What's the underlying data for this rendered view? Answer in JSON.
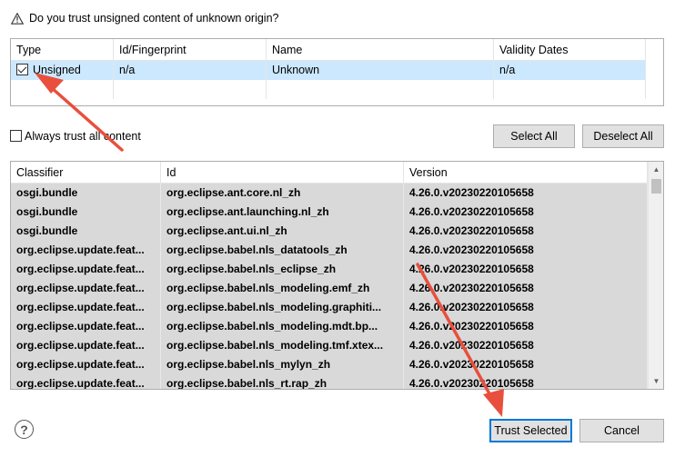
{
  "dialog": {
    "question": "Do you trust unsigned content of unknown origin?",
    "warning_icon": "warning-icon"
  },
  "trust_table": {
    "columns": [
      "Type",
      "Id/Fingerprint",
      "Name",
      "Validity Dates"
    ],
    "rows": [
      {
        "checked": true,
        "type": "Unsigned",
        "id": "n/a",
        "name": "Unknown",
        "validity": "n/a"
      }
    ]
  },
  "always_trust": {
    "label": "Always trust all content",
    "checked": false
  },
  "buttons": {
    "select_all": "Select All",
    "deselect_all": "Deselect All",
    "trust_selected": "Trust Selected",
    "cancel": "Cancel"
  },
  "content_table": {
    "columns": [
      "Classifier",
      "Id",
      "Version"
    ],
    "rows": [
      [
        "osgi.bundle",
        "org.eclipse.ant.core.nl_zh",
        "4.26.0.v20230220105658"
      ],
      [
        "osgi.bundle",
        "org.eclipse.ant.launching.nl_zh",
        "4.26.0.v20230220105658"
      ],
      [
        "osgi.bundle",
        "org.eclipse.ant.ui.nl_zh",
        "4.26.0.v20230220105658"
      ],
      [
        "org.eclipse.update.feat...",
        "org.eclipse.babel.nls_datatools_zh",
        "4.26.0.v20230220105658"
      ],
      [
        "org.eclipse.update.feat...",
        "org.eclipse.babel.nls_eclipse_zh",
        "4.26.0.v20230220105658"
      ],
      [
        "org.eclipse.update.feat...",
        "org.eclipse.babel.nls_modeling.emf_zh",
        "4.26.0.v20230220105658"
      ],
      [
        "org.eclipse.update.feat...",
        "org.eclipse.babel.nls_modeling.graphiti...",
        "4.26.0.v20230220105658"
      ],
      [
        "org.eclipse.update.feat...",
        "org.eclipse.babel.nls_modeling.mdt.bp...",
        "4.26.0.v20230220105658"
      ],
      [
        "org.eclipse.update.feat...",
        "org.eclipse.babel.nls_modeling.tmf.xtex...",
        "4.26.0.v20230220105658"
      ],
      [
        "org.eclipse.update.feat...",
        "org.eclipse.babel.nls_mylyn_zh",
        "4.26.0.v20230220105658"
      ],
      [
        "org.eclipse.update.feat...",
        "org.eclipse.babel.nls_rt.rap_zh",
        "4.26.0.v20230220105658"
      ]
    ]
  },
  "help_icon": "help-icon",
  "colors": {
    "selection": "#cce8ff",
    "row_bg": "#d9d9d9",
    "default_button_border": "#0078d7",
    "annotation_arrow": "#e8503d"
  }
}
